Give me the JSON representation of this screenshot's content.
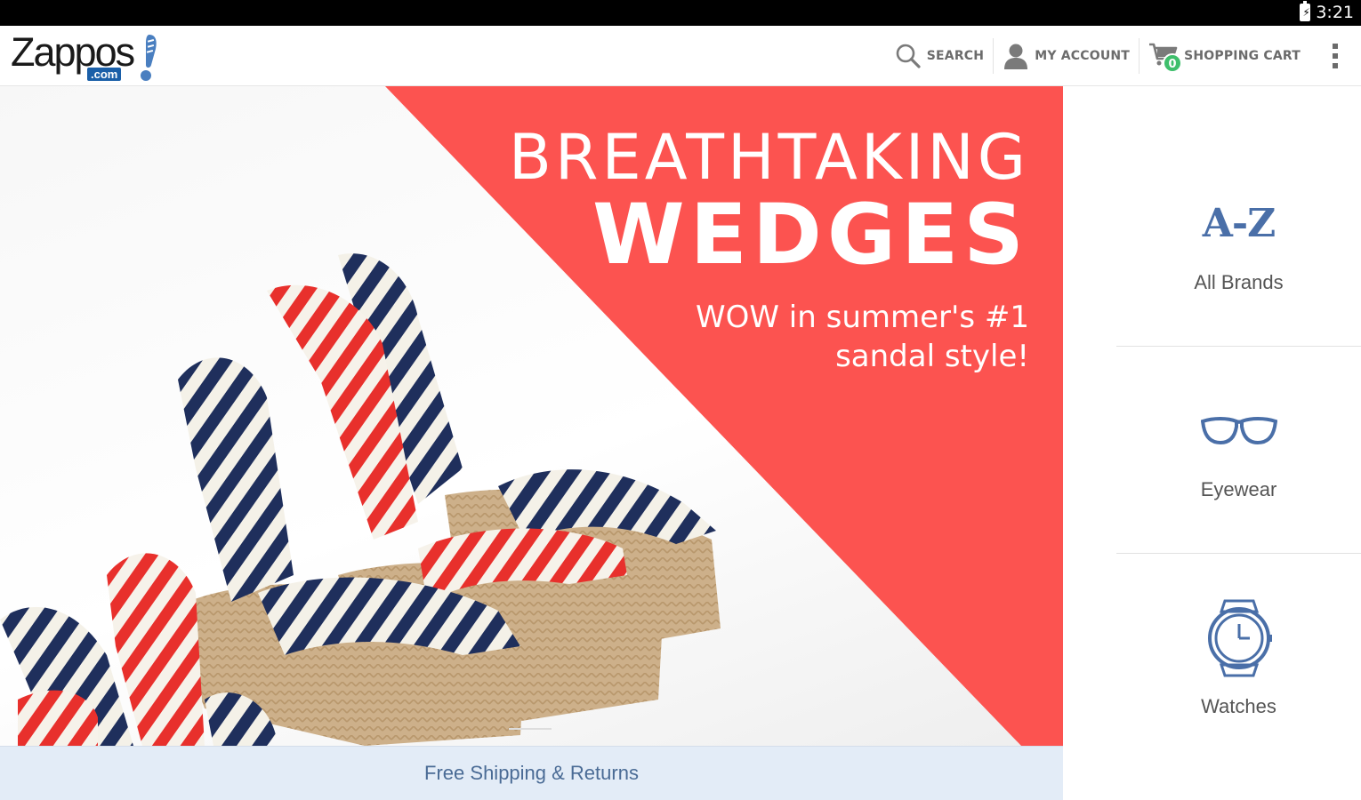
{
  "status_bar": {
    "time": "3:21"
  },
  "header": {
    "logo_text": "Zappos",
    "logo_suffix": ".com",
    "actions": [
      {
        "label": "SEARCH",
        "icon": "search-icon"
      },
      {
        "label": "MY ACCOUNT",
        "icon": "user-icon"
      },
      {
        "label": "SHOPPING CART",
        "icon": "cart-icon",
        "badge": "0"
      }
    ],
    "overflow_icon": "more-vert-icon"
  },
  "hero": {
    "title_line1": "BREATHTAKING",
    "title_line2": "WEDGES",
    "subtitle_line1": "WOW in summer's #1",
    "subtitle_line2": "sandal style!",
    "accent_color": "#fc5350"
  },
  "shipping_banner": {
    "text": "Free Shipping & Returns"
  },
  "categories": [
    {
      "label": "All Brands",
      "icon_text": "A-Z",
      "icon": "a-z-icon"
    },
    {
      "label": "Eyewear",
      "icon": "eyeglasses-icon"
    },
    {
      "label": "Watches",
      "icon": "watch-icon"
    }
  ],
  "colors": {
    "brand_blue": "#4a6fa8",
    "badge_green": "#3fbf6c",
    "shipping_bg": "#e3ecf7"
  }
}
